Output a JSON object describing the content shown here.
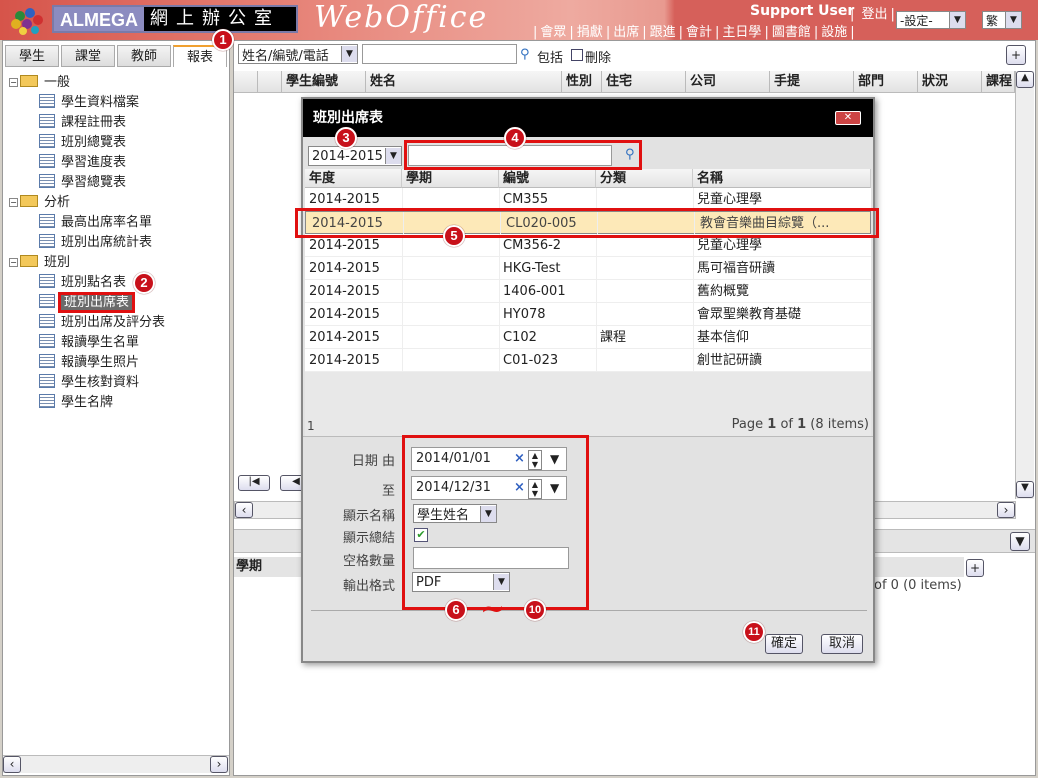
{
  "header": {
    "brand_en": "ALMEGA",
    "brand_zh": "網上辦公室",
    "product": "WebOffice",
    "user": "Support User",
    "logout": "登出",
    "nav": [
      "會眾",
      "捐獻",
      "出席",
      "跟進",
      "會計",
      "主日學",
      "圖書館",
      "設施"
    ],
    "settings_select": "-設定-",
    "lang_select": "繁"
  },
  "left": {
    "tabs": [
      "學生",
      "課堂",
      "教師",
      "報表"
    ],
    "active_tab": 3,
    "tree": [
      {
        "label": "一般",
        "items": [
          "學生資料檔案",
          "課程註冊表",
          "班別總覽表",
          "學習進度表",
          "學習總覽表"
        ]
      },
      {
        "label": "分析",
        "items": [
          "最高出席率名單",
          "班別出席統計表"
        ]
      },
      {
        "label": "班別",
        "items": [
          "班別點名表",
          "班別出席表",
          "班別出席及評分表",
          "報讀學生名單",
          "報讀學生照片",
          "學生核對資料",
          "學生名牌"
        ]
      }
    ],
    "selected": "班別出席表"
  },
  "main": {
    "search_field": "姓名/編號/電話",
    "search_value": "",
    "include_label": "包括",
    "deleted_label": "刪除",
    "columns": [
      "學生編號",
      "姓名",
      "性別",
      "住宅",
      "公司",
      "手提",
      "部門",
      "狀況",
      "課程"
    ],
    "lower_column": "學期",
    "lower_pager": "of 0 (0 items)",
    "add": "+"
  },
  "dialog": {
    "title": "班別出席表",
    "year_select": "2014-2015",
    "search_value": "",
    "columns": [
      "年度",
      "學期",
      "編號",
      "分類",
      "名稱"
    ],
    "rows": [
      [
        "2014-2015",
        "",
        "CM355",
        "",
        "兒童心理學"
      ],
      [
        "2014-2015",
        "",
        "CL020-005",
        "",
        "教會音樂曲目綜覽（..."
      ],
      [
        "2014-2015",
        "",
        "CM356-2",
        "",
        "兒童心理學"
      ],
      [
        "2014-2015",
        "",
        "HKG-Test",
        "",
        "馬可福音研讀"
      ],
      [
        "2014-2015",
        "",
        "1406-001",
        "",
        "舊約概覽"
      ],
      [
        "2014-2015",
        "",
        "HY078",
        "",
        "會眾聖樂教育基礎"
      ],
      [
        "2014-2015",
        "",
        "C102",
        "課程",
        "基本信仰"
      ],
      [
        "2014-2015",
        "",
        "C01-023",
        "",
        "創世記研讀"
      ]
    ],
    "selected_row": 1,
    "pager_left": "1",
    "pager_page": "Page",
    "pager_cur": "1",
    "pager_of": "of",
    "pager_total": "1",
    "pager_items": "(8 items)",
    "form": {
      "date_from_label": "日期 由",
      "date_from": "2014/01/01",
      "date_to_label": "至",
      "date_to": "2014/12/31",
      "display_name_label": "顯示名稱",
      "display_name": "學生姓名",
      "show_summary_label": "顯示總結",
      "show_summary": true,
      "blank_count_label": "空格數量",
      "blank_count": "",
      "output_label": "輸出格式",
      "output": "PDF"
    },
    "ok": "確定",
    "cancel": "取消"
  },
  "markers": [
    "1",
    "2",
    "3",
    "4",
    "5",
    "6",
    "~",
    "10",
    "11"
  ],
  "colors": {
    "header": "#d6605a",
    "highlight": "#e01010",
    "selected_row": "#fde9b8",
    "dialog_title": "#000000"
  }
}
